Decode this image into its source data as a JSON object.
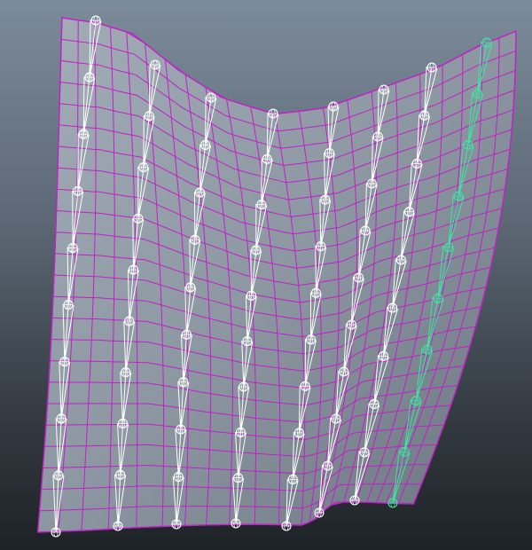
{
  "viewport": {
    "name": "3D viewport",
    "background": {
      "top": "#7c8b9b",
      "bottom": "#1d2226"
    }
  },
  "cloth_mesh": {
    "type": "polygon-plane",
    "display": "wireframe-on-shaded",
    "wire_color": "#c21fc9",
    "shade_color": "#8f9aa4",
    "grid": {
      "columns": 22,
      "rows": 24
    }
  },
  "joint_chains": {
    "count": 8,
    "joints_per_chain": 10,
    "default_color": "#ffffff",
    "selected_color": "#3fe4a0",
    "selected_chain_index": 7,
    "icon": "joint-bone-icon"
  }
}
